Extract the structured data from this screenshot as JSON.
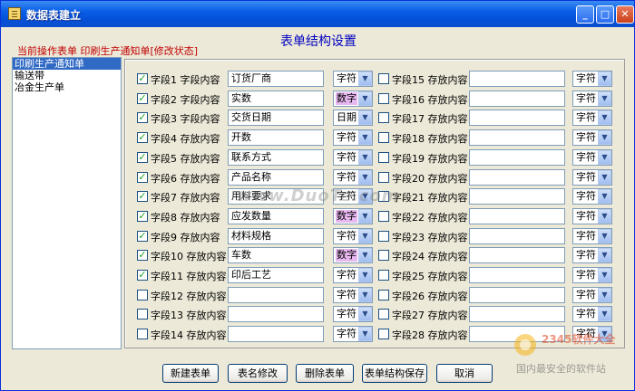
{
  "window": {
    "title": "数据表建立"
  },
  "header": {
    "title": "表单结构设置",
    "status": "当前操作表单 印刷生产通知单[修改状态]"
  },
  "table_list": {
    "items": [
      "印刷生产通知单",
      "输送带",
      "冶金生产单"
    ],
    "selected": 0
  },
  "fields_left": [
    {
      "label": "字段1 字段内容",
      "checked": true,
      "value": "订货厂商",
      "type": "字符",
      "type_hl": false
    },
    {
      "label": "字段2 字段内容",
      "checked": true,
      "value": "实数",
      "type": "数字",
      "type_hl": true
    },
    {
      "label": "字段3 字段内容",
      "checked": true,
      "value": "交货日期",
      "type": "日期",
      "type_hl": false
    },
    {
      "label": "字段4 存放内容",
      "checked": true,
      "value": "开数",
      "type": "字符",
      "type_hl": false
    },
    {
      "label": "字段5 存放内容",
      "checked": true,
      "value": "联系方式",
      "type": "字符",
      "type_hl": false
    },
    {
      "label": "字段6 存放内容",
      "checked": true,
      "value": "产品名称",
      "type": "字符",
      "type_hl": false
    },
    {
      "label": "字段7 存放内容",
      "checked": true,
      "value": "用料要求",
      "type": "字符",
      "type_hl": false
    },
    {
      "label": "字段8 存放内容",
      "checked": true,
      "value": "应发数量",
      "type": "数字",
      "type_hl": true
    },
    {
      "label": "字段9 存放内容",
      "checked": true,
      "value": "材料规格",
      "type": "字符",
      "type_hl": false
    },
    {
      "label": "字段10 存放内容",
      "checked": true,
      "value": "车数",
      "type": "数字",
      "type_hl": true
    },
    {
      "label": "字段11 存放内容",
      "checked": true,
      "value": "印后工艺",
      "type": "字符",
      "type_hl": false
    },
    {
      "label": "字段12 存放内容",
      "checked": false,
      "value": "",
      "type": "字符",
      "type_hl": false
    },
    {
      "label": "字段13 存放内容",
      "checked": false,
      "value": "",
      "type": "字符",
      "type_hl": false
    },
    {
      "label": "字段14 存放内容",
      "checked": false,
      "value": "",
      "type": "字符",
      "type_hl": false
    }
  ],
  "fields_right": [
    {
      "label": "字段15 存放内容",
      "checked": false,
      "value": "",
      "type": "字符",
      "type_hl": false
    },
    {
      "label": "字段16 存放内容",
      "checked": false,
      "value": "",
      "type": "字符",
      "type_hl": false
    },
    {
      "label": "字段17 存放内容",
      "checked": false,
      "value": "",
      "type": "字符",
      "type_hl": false
    },
    {
      "label": "字段18 存放内容",
      "checked": false,
      "value": "",
      "type": "字符",
      "type_hl": false
    },
    {
      "label": "字段19 存放内容",
      "checked": false,
      "value": "",
      "type": "字符",
      "type_hl": false
    },
    {
      "label": "字段20 存放内容",
      "checked": false,
      "value": "",
      "type": "字符",
      "type_hl": false
    },
    {
      "label": "字段21 存放内容",
      "checked": false,
      "value": "",
      "type": "字符",
      "type_hl": false
    },
    {
      "label": "字段22 存放内容",
      "checked": false,
      "value": "",
      "type": "字符",
      "type_hl": false
    },
    {
      "label": "字段23 存放内容",
      "checked": false,
      "value": "",
      "type": "字符",
      "type_hl": false
    },
    {
      "label": "字段24 存放内容",
      "checked": false,
      "value": "",
      "type": "字符",
      "type_hl": false
    },
    {
      "label": "字段25 存放内容",
      "checked": false,
      "value": "",
      "type": "字符",
      "type_hl": false
    },
    {
      "label": "字段26 存放内容",
      "checked": false,
      "value": "",
      "type": "字符",
      "type_hl": false
    },
    {
      "label": "字段27 存放内容",
      "checked": false,
      "value": "",
      "type": "字符",
      "type_hl": false
    },
    {
      "label": "字段28 存放内容",
      "checked": false,
      "value": "",
      "type": "字符",
      "type_hl": false
    }
  ],
  "buttons": {
    "new": "新建表单",
    "rename": "表名修改",
    "delete": "删除表单",
    "save": "表单结构保存",
    "cancel": "取消"
  },
  "watermark": {
    "site": "www.DuoTe.com",
    "brand": "2345软件大全",
    "slogan": "国内最安全的软件站"
  },
  "colors": {
    "title_bar": "#0a5ee6",
    "header_title": "#0000c0",
    "status_text": "#c00000",
    "selection": "#316ac5",
    "number_type_highlight": "#e8b8f0"
  }
}
